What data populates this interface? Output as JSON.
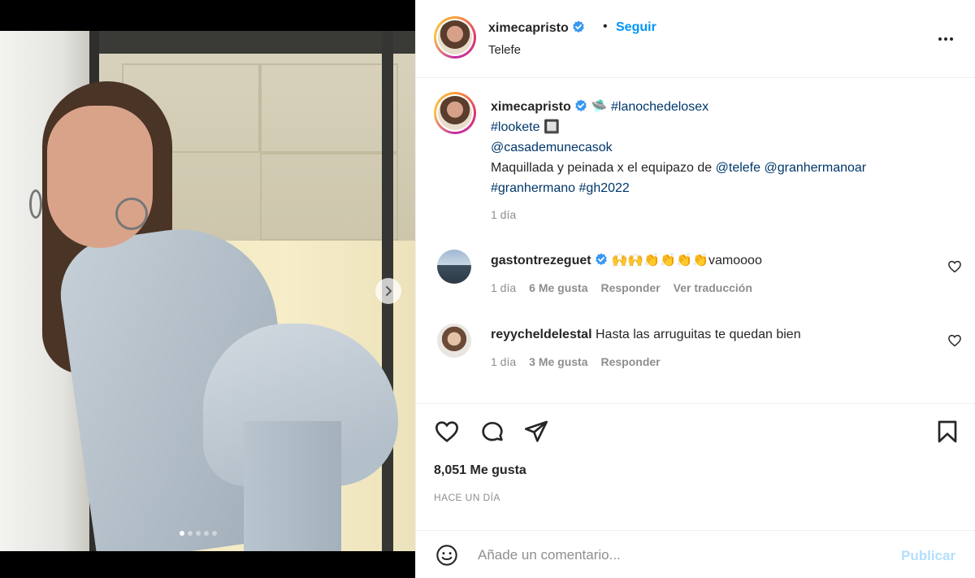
{
  "header": {
    "username": "ximecapristo",
    "separator": "•",
    "follow_label": "Seguir",
    "location": "Telefe"
  },
  "caption": {
    "username": "ximecapristo",
    "emoji": "🛸",
    "line1_tag": "#lanochedelosex",
    "line2_tag": "#lookete",
    "line2_suffix": " 🔲",
    "line3_mention": "@casademunecasok",
    "line4_text": "Maquillada y peinada x el equipazo de ",
    "line4_mention1": "@telefe",
    "line4_mention2": "@granhermanoar",
    "line5_tag1": "#granhermano",
    "line5_tag2": "#gh2022",
    "time": "1 día"
  },
  "comments": [
    {
      "username": "gastontrezeguet",
      "text": "🙌🙌👏👏👏👏vamoooo",
      "time": "1 día",
      "likes": "6 Me gusta",
      "reply": "Responder",
      "translate": "Ver traducción"
    },
    {
      "username": "reyycheldelestal",
      "text": "Hasta las arruguitas te quedan bien",
      "time": "1 día",
      "likes": "3 Me gusta",
      "reply": "Responder"
    }
  ],
  "actions": {
    "likes_count": "8,051 Me gusta",
    "posted_when": "HACE UN DÍA"
  },
  "comment_bar": {
    "placeholder": "Añade un comentario...",
    "publish_label": "Publicar"
  },
  "carousel": {
    "total_slides": 5,
    "active_slide": 1
  },
  "colors": {
    "link_blue": "#0095f6",
    "tag_blue": "#00376b",
    "muted": "#8e8e8e",
    "publish_disabled": "#b2dffc",
    "verified_blue": "#3897f0"
  }
}
